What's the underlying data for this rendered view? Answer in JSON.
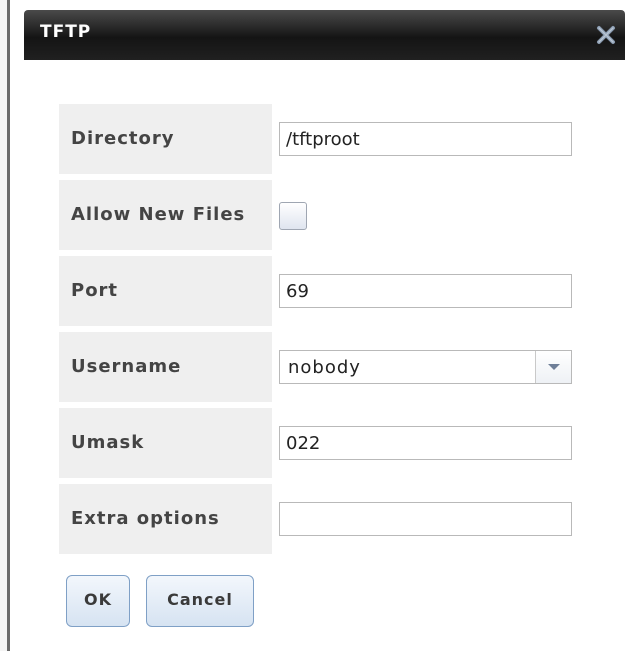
{
  "dialog": {
    "title": "TFTP",
    "close_icon": "close-x-icon"
  },
  "form": {
    "directory": {
      "label": "Directory",
      "value": "/tftproot"
    },
    "allow_new_files": {
      "label": "Allow New Files",
      "checked": false
    },
    "port": {
      "label": "Port",
      "value": "69"
    },
    "username": {
      "label": "Username",
      "selected": "nobody"
    },
    "umask": {
      "label": "Umask",
      "value": "022"
    },
    "extra_options": {
      "label": "Extra options",
      "value": ""
    }
  },
  "buttons": {
    "ok_label": "OK",
    "cancel_label": "Cancel"
  },
  "colors": {
    "titlebar": "#1a1a1a",
    "label_background": "#efefef",
    "button_border": "#7fa0c6"
  }
}
